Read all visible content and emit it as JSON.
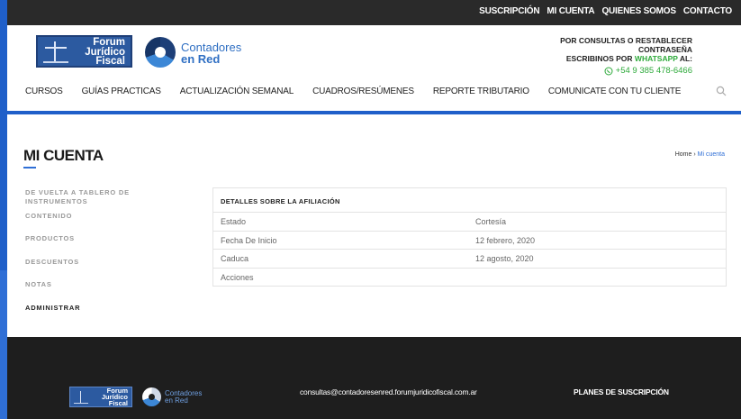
{
  "topbar": {
    "links": [
      "SUSCRIPCIÓN",
      "MI CUENTA",
      "QUIENES SOMOS",
      "CONTACTO"
    ]
  },
  "header": {
    "logo_fjf_lines": [
      "Forum",
      "Jurídico",
      "Fiscal"
    ],
    "logo_cr_line1": "Contadores",
    "logo_cr_line2": "en Red",
    "contact_line1": "POR CONSULTAS O RESTABLECER CONTRASEÑA",
    "contact_line2_pre": "ESCRIBINOS POR",
    "contact_line2_wa": "WHATSAPP",
    "contact_line2_post": "AL:",
    "phone": "+54 9 385 478-6466"
  },
  "nav": {
    "items": [
      "CURSOS",
      "GUÍAS PRACTICAS",
      "ACTUALIZACIÓN SEMANAL",
      "CUADROS/RESÚMENES",
      "REPORTE TRIBUTARIO",
      "COMUNICATE CON TU CLIENTE"
    ]
  },
  "page": {
    "title": "MI CUENTA",
    "breadcrumb_home": "Home",
    "breadcrumb_sep": " › ",
    "breadcrumb_current": "Mi cuenta"
  },
  "sidebar": {
    "items": [
      "DE VUELTA A TABLERO DE INSTRUMENTOS",
      "CONTENIDO",
      "PRODUCTOS",
      "DESCUENTOS",
      "NOTAS",
      "ADMINISTRAR"
    ]
  },
  "membership": {
    "heading": "DETALLES SOBRE LA AFILIACIÓN",
    "rows": [
      {
        "label": "Estado",
        "value": "Cortesía"
      },
      {
        "label": "Fecha De Inicio",
        "value": "12 febrero, 2020"
      },
      {
        "label": "Caduca",
        "value": "12 agosto, 2020"
      },
      {
        "label": "Acciones",
        "value": ""
      }
    ]
  },
  "footer": {
    "logo_fjf_lines": [
      "Forum",
      "Jurídico",
      "Fiscal"
    ],
    "logo_cr_line1": "Contadores",
    "logo_cr_line2": "en Red",
    "email": "consultas@contadoresenred.forumjuridicofiscal.com.ar",
    "plans": "PLANES DE SUSCRIPCIÓN"
  },
  "colors": {
    "accent": "#2f6fd6",
    "topbar": "#2a2a2a",
    "footer": "#1e1e1e",
    "whatsapp": "#2eaa3b"
  }
}
